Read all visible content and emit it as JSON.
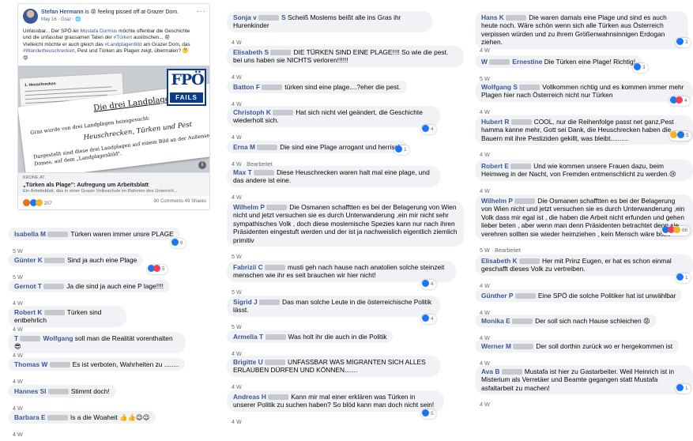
{
  "post": {
    "author": "Stefan Hermann",
    "feeling": "is 😡 feeling pissed off at Grazer Dom.",
    "meta": "May 16 · Graz · 🌐",
    "more": "···",
    "text_1": "Unfassbar... Der SPÖ-ler ",
    "text_1_link": "Mustafa Durmus",
    "text_1b": " möchte offenbar die Geschichte",
    "text_2": "und die unfassbar grausamen Taten der ",
    "text_2_link": "#Türken",
    "text_2b": " auslöschen... 😡",
    "text_3": "Vielleicht möchte er auch gleich das ",
    "text_3_link": "#Landplagenbild",
    "text_3b": " am Grazer Dom, das",
    "text_4_link": "#Wanderheuschrecken",
    "text_4b": ", Pest und Türken als Plagen zeigt, übermalen? 🤔",
    "text_5": "😡",
    "image": {
      "sheet_title": "1. Heuschrecken",
      "paper_title": "Die drei Landplagen",
      "paper_line1": "Graz wurde von drei Landplagen heimgesucht:",
      "paper_line2": "Heuschrecken, Türken und Pest",
      "paper_line3": "Dargestellt sind diese drei Landplagen auf einem Bild an der Außenseite des",
      "paper_line4": "Domes, auf dem „Landplagenbild\".",
      "logo_top": "FPÖ",
      "logo_bottom": "FAILS",
      "info": "i"
    },
    "link": {
      "source": "KRONE.AT",
      "title": "„Türken als Plage\": Aufregung um Arbeitsblatt",
      "desc": "Ein Arbeitsblatt, das in einer Grazer Volksschule im Rahmen des Unterrich..."
    },
    "reactions": "207",
    "stats": "90 Comments  49 Shares"
  },
  "columns": [
    [
      {
        "name": "Isabella M",
        "text": "Türken waren immer unsre PLAGE",
        "time": "5 W",
        "react": "6",
        "icons": [
          "like"
        ]
      },
      {
        "name": "Günter K",
        "text": "Sind ja auch eine Plage",
        "time": "5 W",
        "react": "5",
        "icons": [
          "like",
          "love"
        ]
      },
      {
        "name": "Gernot T",
        "text": "Ja die sind ja auch eine P lage!!!!",
        "time": "4 W",
        "react": "",
        "icons": []
      },
      {
        "name": "Robert K",
        "text": "Türken sind entbehrlich",
        "time": "4 W",
        "react": "",
        "icons": []
      },
      {
        "name": "T",
        "name2": "Wolfgang",
        "text": "soll man die Realität vorenthalten 😎",
        "time": "4 W",
        "react": "",
        "icons": []
      },
      {
        "name": "Thomas W",
        "text": "Es ist verboten, Wahrheiten zu ........",
        "time": "4 W",
        "react": "",
        "icons": []
      },
      {
        "name": "Hannes Sl",
        "text": "Stimmt doch!",
        "time": "4 W",
        "react": "",
        "icons": []
      },
      {
        "name": "Barbara E",
        "text": "Is a die Woaheit 👍👍😉😉",
        "time": "4 W",
        "react": "",
        "icons": []
      }
    ],
    [
      {
        "name": "Sonja v",
        "name2": "S",
        "text": "Scheiß Moslems beißt alle ins Gras ihr Hurenkinder",
        "time": "4 W",
        "react": "",
        "icons": []
      },
      {
        "name": "Elisabeth S",
        "text": "DIE TÜRKEN SIND EINE PLAGE!!!! So wie die pest. bei uns haben sie NICHTS verloren!!!!!!",
        "time": "4 W",
        "react": "",
        "icons": []
      },
      {
        "name": "Batton F",
        "text": "türken sind eine plage....?eher die pest.",
        "time": "4 W",
        "react": "",
        "icons": []
      },
      {
        "name": "Christoph K",
        "text": "Hat sich nicht viel geändert, die Geschichte wiederholt sich.",
        "time": "4 W",
        "react": "4",
        "icons": [
          "like"
        ]
      },
      {
        "name": "Erna M",
        "text": "Die sind eine Plage arrogant und herrisch",
        "time": "4 W · Bearbeitet",
        "react": "1",
        "icons": [
          "like"
        ]
      },
      {
        "name": "Max T",
        "text": "Diese Heuschrecken waren halt mal eine plage, und das andere ist eine.",
        "time": "4 W",
        "react": "",
        "icons": []
      },
      {
        "name": "Wilhelm P",
        "text": "Die Osmanen schafftten es bei der Belagerung von Wien nicht und jetzt versuchen sie es durch Unterwanderung ,ein mir nicht sehr sympathisches Volk , doch diese moslemische Spezies kann nur nach ihren Präsidenten eingestuft werden und der ist ja nachweislich eigentlich ziemlich primitiv",
        "time": "5 W",
        "react": "",
        "icons": []
      },
      {
        "name": "Fabrizii C",
        "text": "musti geh nach hause nach anatolien solche steinzeit menschen wie ihr es seit brauchen wir hier nicht!",
        "time": "5 W",
        "react": "4",
        "icons": [
          "like"
        ]
      },
      {
        "name": "Sigrid J",
        "text": "Das man solche Leute in die österreichische Politik lässt.",
        "time": "5 W",
        "react": "4",
        "icons": [
          "like"
        ]
      },
      {
        "name": "Armella T",
        "text": "Was holt ihr die auch in die Politik",
        "time": "4 W",
        "react": "",
        "icons": []
      },
      {
        "name": "Brigitte U",
        "text": "UNFASSBAR WAS MIGRANTEN SICH ALLES ERLAUBEN DÜRFEN UND KÖNNEN.......",
        "time": "4 W",
        "react": "",
        "icons": []
      },
      {
        "name": "Andreas H",
        "text": "Kann mir mal einer erklären was Türken in unserer Politik zu suchen haben? So blöd kann man doch nicht sein!",
        "time": "4 W",
        "react": "5",
        "icons": [
          "like"
        ]
      }
    ],
    [
      {
        "name": "Hans K",
        "text": "Die waren damals eine Plage und sind es auch heute noch. Wäre schön wenn sich alle Türken aus Österreich verpissen würden und zu ihrem Größenwahnsinnigen Erdogan ziehen.",
        "time": "4 W",
        "react": "3",
        "icons": [
          "like"
        ]
      },
      {
        "name": "W",
        "name2": "Ernestine",
        "text": "Die Türken eine Plage! Richtig!",
        "time": "5 W",
        "react": "3",
        "icons": [
          "like"
        ]
      },
      {
        "name": "Wolfgang S",
        "text": "Vollkommen richtig und es kommen immer mehr Plagen hier nach Österreich nicht nur Türken",
        "time": "4 W",
        "react": "4",
        "icons": [
          "like",
          "love"
        ]
      },
      {
        "name": "Hubert R",
        "text": "COOL, nur die Reihenfolge passt net ganz,Pest hamma kanne mehr, Gott sei Dank, die Heuschrecken haben die Bauern mit ihre Pestiziden gekillt, was bleibt..........",
        "time": "4 W",
        "react": "5",
        "icons": [
          "haha",
          "like"
        ]
      },
      {
        "name": "Robert E",
        "text": "Und wie kommen unsere Frauen dazu, beim Heimweg in der Nacht, von Fremden entmenschlicht zu werden.😢",
        "time": "4 W",
        "react": "",
        "icons": []
      },
      {
        "name": "Wilhelm P",
        "text": "Die Osmanen schafftten es bei der Belagerung von Wien nicht und jetzt versuchen sie es durch Unterwanderung ,ein Volk dass mir egal ist , die haben die Arbeit nicht erfunden und gehen lieber beten , aber wenn man denn Präsidenten betrachtet denn sie verehren sollten sie wieder heimziehen , kein Mensch wäre böse",
        "time": "5 W · Bearbeitet",
        "react": "88",
        "icons": [
          "like",
          "love",
          "haha"
        ]
      },
      {
        "name": "Elisabeth K",
        "text": "Her mit Prinz Eugen, er hat es schon einmal geschafft dieses Volk zu vertreiben.",
        "time": "4 W",
        "react": "1",
        "icons": [
          "like"
        ]
      },
      {
        "name": "Günther P",
        "text": "Eine SPÖ die solche Politiker hat ist unwählbar",
        "time": "4 W",
        "react": "",
        "icons": []
      },
      {
        "name": "Monika E",
        "text": "Der soll sich nach Hause schleichen 😡",
        "time": "4 W",
        "react": "",
        "icons": []
      },
      {
        "name": "Werner M",
        "text": "Der soll dorthin zurück wo er hergekommen ist",
        "time": "4 W",
        "react": "",
        "icons": []
      },
      {
        "name": "Ava B",
        "text": "Mustafa ist hier zu Gastarbeiter. Weil Heinrich ist in Misterium als Verretäer und Beamte gegangen statt Mustafa asfaltarbeit zu machen!",
        "time": "4 W",
        "react": "1",
        "icons": [
          "like"
        ]
      }
    ]
  ]
}
